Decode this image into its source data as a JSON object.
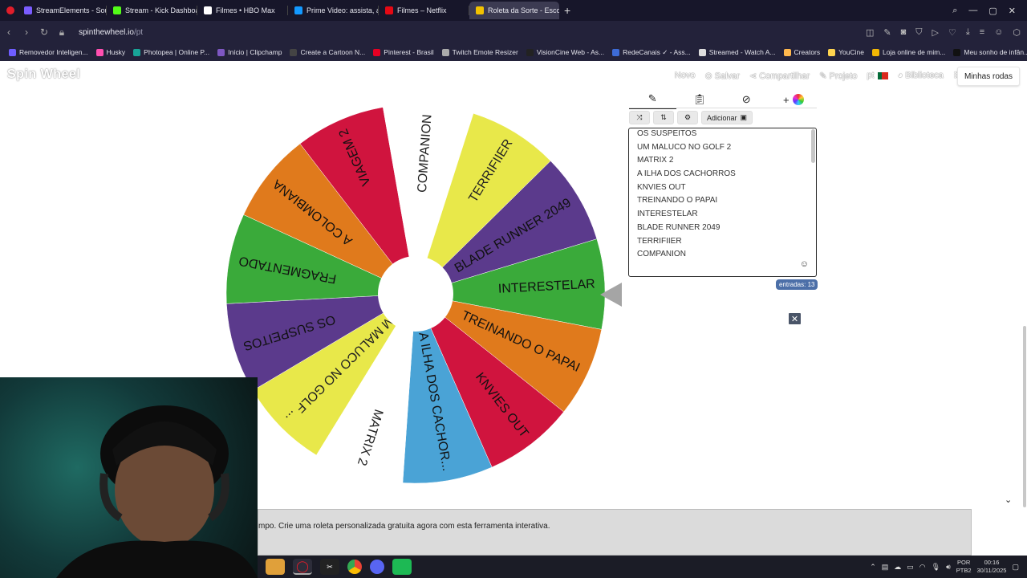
{
  "browser": {
    "tabs": [
      {
        "label": "StreamElements - Sou",
        "color": "#7a5cff",
        "active": false
      },
      {
        "label": "Stream - Kick Dashboard",
        "color": "#53fc18",
        "active": false
      },
      {
        "label": "Filmes • HBO Max",
        "color": "#ffffff",
        "active": false
      },
      {
        "label": "Prime Video: assista, alug",
        "color": "#1399ff",
        "active": false
      },
      {
        "label": "Filmes – Netflix",
        "color": "#e50914",
        "active": false
      },
      {
        "label": "Roleta da Sorte - Escolha",
        "color": "#f2c200",
        "active": true
      }
    ],
    "new_tab": "+",
    "url_host": "spinthewheel.io",
    "url_path": "/pt",
    "bookmarks": [
      {
        "label": "Removedor Inteligen...",
        "color": "#6f5dff"
      },
      {
        "label": "Husky",
        "color": "#ff4fb0"
      },
      {
        "label": "Photopea | Online P...",
        "color": "#18a497"
      },
      {
        "label": "Início | Clipchamp",
        "color": "#7e57c2"
      },
      {
        "label": "Create a Cartoon N...",
        "color": "#444444"
      },
      {
        "label": "Pinterest - Brasil",
        "color": "#e60023"
      },
      {
        "label": "Twitch Emote Resizer",
        "color": "#aaaaaa"
      },
      {
        "label": "VisionCine Web - As...",
        "color": "#222222"
      },
      {
        "label": "RedeCanais ✓ - Ass...",
        "color": "#3d6bd6"
      },
      {
        "label": "Streamed - Watch A...",
        "color": "#dddddd"
      },
      {
        "label": "Creators",
        "color": "#ffb84d"
      },
      {
        "label": "YouCine",
        "color": "#ffd54f"
      },
      {
        "label": "Loja online de mim...",
        "color": "#f2b705"
      },
      {
        "label": "Meu sonho de infân...",
        "color": "#111111"
      }
    ]
  },
  "page": {
    "logo": "Spin Wheel",
    "top_links": {
      "new": "Novo",
      "save": "Salvar",
      "share": "Compartilhar",
      "project": "Projeto",
      "language": "pt",
      "library": "Biblioteca",
      "my_wheels": "Minhas rodas"
    },
    "add_label": "Adicionar",
    "entries": [
      "OS SUSPEITOS",
      "UM MALUCO NO GOLF 2",
      "MATRIX 2",
      "A ILHA DOS CACHORROS",
      "KNVIES OUT",
      "TREINANDO O PAPAI",
      "INTERESTELAR",
      "BLADE RUNNER 2049",
      "TERRIFIIER",
      "COMPANION"
    ],
    "entry_count": "entradas: 13",
    "footer_text": "mpo. Crie uma roleta personalizada gratuita agora com esta ferramenta interativa."
  },
  "wheel": {
    "segments": [
      {
        "label": "INTERESTELAR",
        "color": "#3aaa3a"
      },
      {
        "label": "TREINANDO O PAPAI",
        "color": "#e07a1c"
      },
      {
        "label": "KNVIES OUT",
        "color": "#d0143e"
      },
      {
        "label": "A ILHA DOS CACHOR...",
        "color": "#4aa3d6"
      },
      {
        "label": "MATRIX 2",
        "color": "#ffffff"
      },
      {
        "label": "UM MALUCO NO GOLF ...",
        "color": "#e8e84a"
      },
      {
        "label": "OS SUSPEITOS",
        "color": "#5b3a8c"
      },
      {
        "label": "FRAGMENTADO",
        "color": "#3aaa3a"
      },
      {
        "label": "A COLOMBIANA",
        "color": "#e07a1c"
      },
      {
        "label": "VIAGEM 2",
        "color": "#d0143e"
      },
      {
        "label": "COMPANION",
        "color": "#ffffff"
      },
      {
        "label": "TERRIFIIER",
        "color": "#e8e84a"
      },
      {
        "label": "BLADE RUNNER 2049",
        "color": "#5b3a8c"
      }
    ]
  },
  "taskbar": {
    "language": "POR",
    "layout": "PTB2",
    "time": "00:16",
    "date": "30/11/2025"
  }
}
